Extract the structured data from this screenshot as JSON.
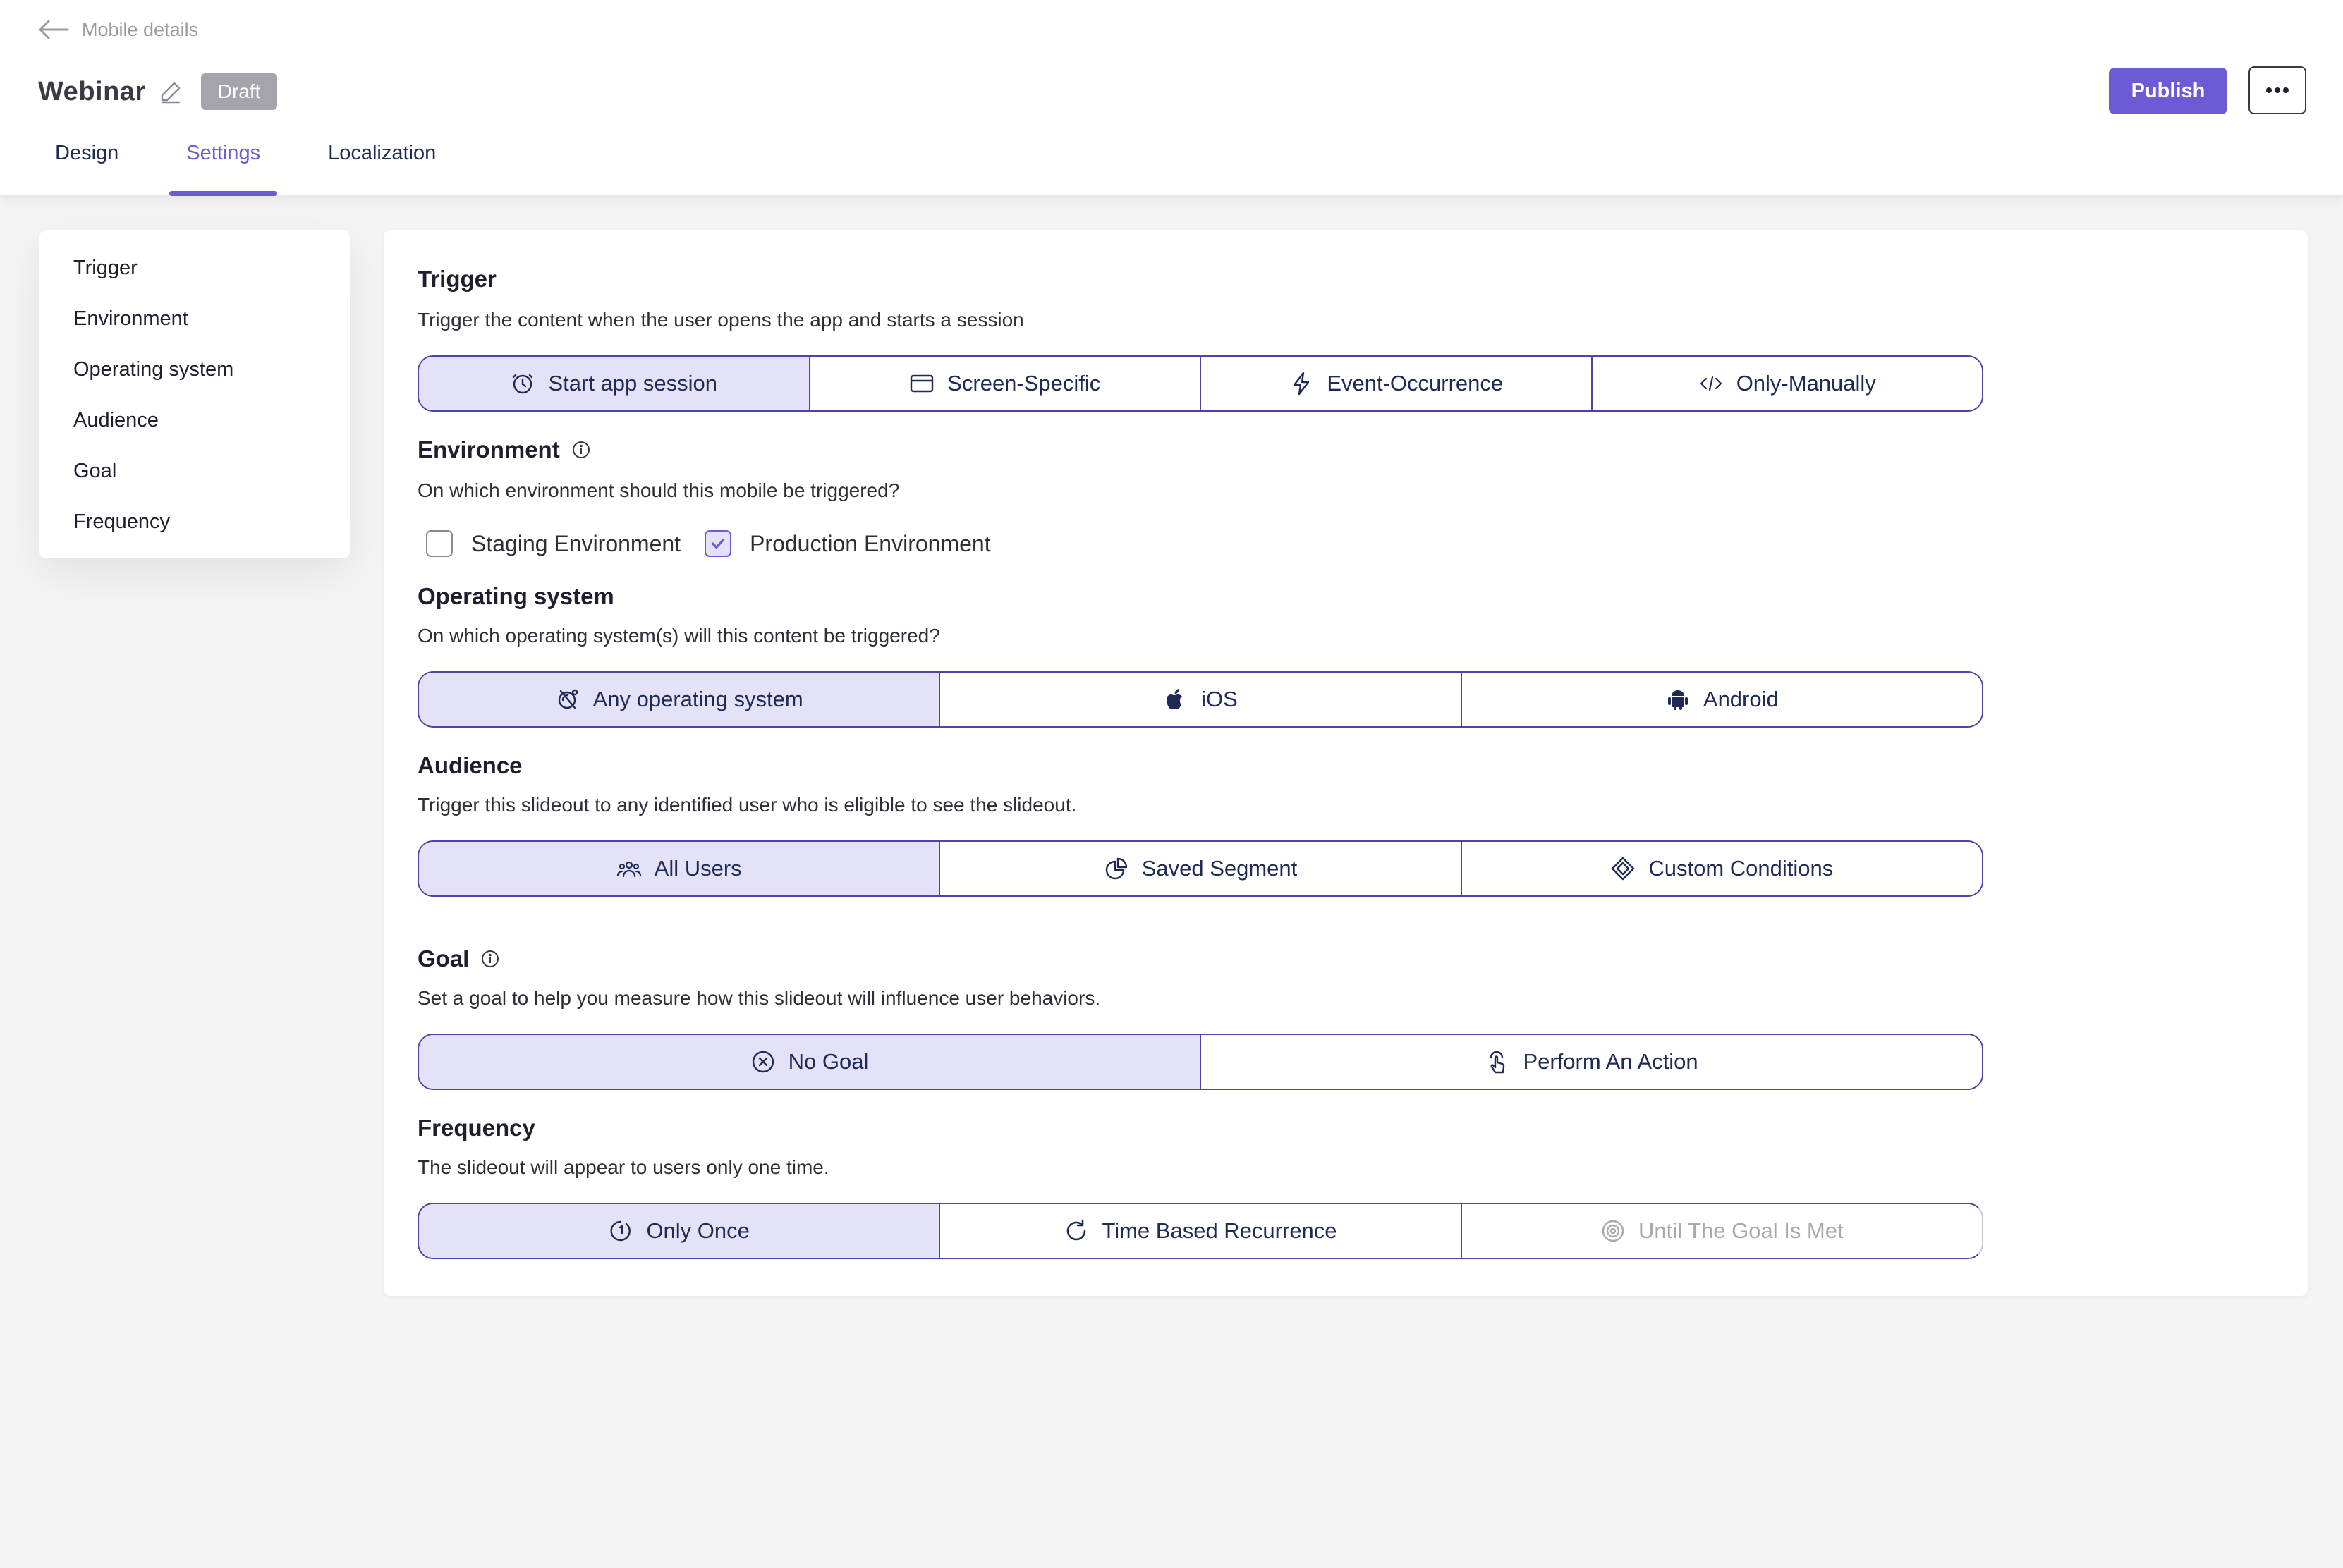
{
  "header": {
    "back_label": "Mobile details",
    "title": "Webinar",
    "status": "Draft",
    "publish_label": "Publish",
    "tabs": [
      {
        "label": "Design",
        "active": false
      },
      {
        "label": "Settings",
        "active": true
      },
      {
        "label": "Localization",
        "active": false
      }
    ]
  },
  "sidebar": {
    "items": [
      {
        "label": "Trigger"
      },
      {
        "label": "Environment"
      },
      {
        "label": "Operating system"
      },
      {
        "label": "Audience"
      },
      {
        "label": "Goal"
      },
      {
        "label": "Frequency"
      }
    ]
  },
  "trigger": {
    "title": "Trigger",
    "description": "Trigger the content when the user opens the app and starts a session",
    "options": [
      {
        "label": "Start app session",
        "icon": "clock-icon",
        "selected": true
      },
      {
        "label": "Screen-Specific",
        "icon": "screen-icon",
        "selected": false
      },
      {
        "label": "Event-Occurrence",
        "icon": "lightning-icon",
        "selected": false
      },
      {
        "label": "Only-Manually",
        "icon": "code-icon",
        "selected": false
      }
    ]
  },
  "environment": {
    "title": "Environment",
    "description": "On which environment should this mobile be triggered?",
    "options": [
      {
        "label": "Staging Environment",
        "checked": false
      },
      {
        "label": "Production Environment",
        "checked": true
      }
    ]
  },
  "operating_system": {
    "title": "Operating system",
    "description": "On which operating system(s) will this content be triggered?",
    "options": [
      {
        "label": "Any operating system",
        "icon": "any-os-icon",
        "selected": true
      },
      {
        "label": "iOS",
        "icon": "apple-icon",
        "selected": false
      },
      {
        "label": "Android",
        "icon": "android-icon",
        "selected": false
      }
    ]
  },
  "audience": {
    "title": "Audience",
    "description": "Trigger this slideout to any identified user who is eligible to see the slideout.",
    "options": [
      {
        "label": "All Users",
        "icon": "users-icon",
        "selected": true
      },
      {
        "label": "Saved Segment",
        "icon": "pie-chart-icon",
        "selected": false
      },
      {
        "label": "Custom Conditions",
        "icon": "diamond-icon",
        "selected": false
      }
    ]
  },
  "goal": {
    "title": "Goal",
    "description": "Set a goal to help you measure how this slideout will influence user behaviors.",
    "options": [
      {
        "label": "No Goal",
        "icon": "circle-x-icon",
        "selected": true
      },
      {
        "label": "Perform An Action",
        "icon": "tap-icon",
        "selected": false
      }
    ]
  },
  "frequency": {
    "title": "Frequency",
    "description": "The slideout will appear to users only one time.",
    "options": [
      {
        "label": "Only Once",
        "icon": "once-icon",
        "selected": true
      },
      {
        "label": "Time Based Recurrence",
        "icon": "refresh-icon",
        "selected": false
      },
      {
        "label": "Until The Goal Is Met",
        "icon": "target-icon",
        "selected": false,
        "disabled": true
      }
    ]
  },
  "colors": {
    "accent": "#6b5cd6",
    "selected_bg": "#e4e2f8",
    "segment_border": "#4b45a8",
    "badge_bg": "#a4a4aa"
  }
}
